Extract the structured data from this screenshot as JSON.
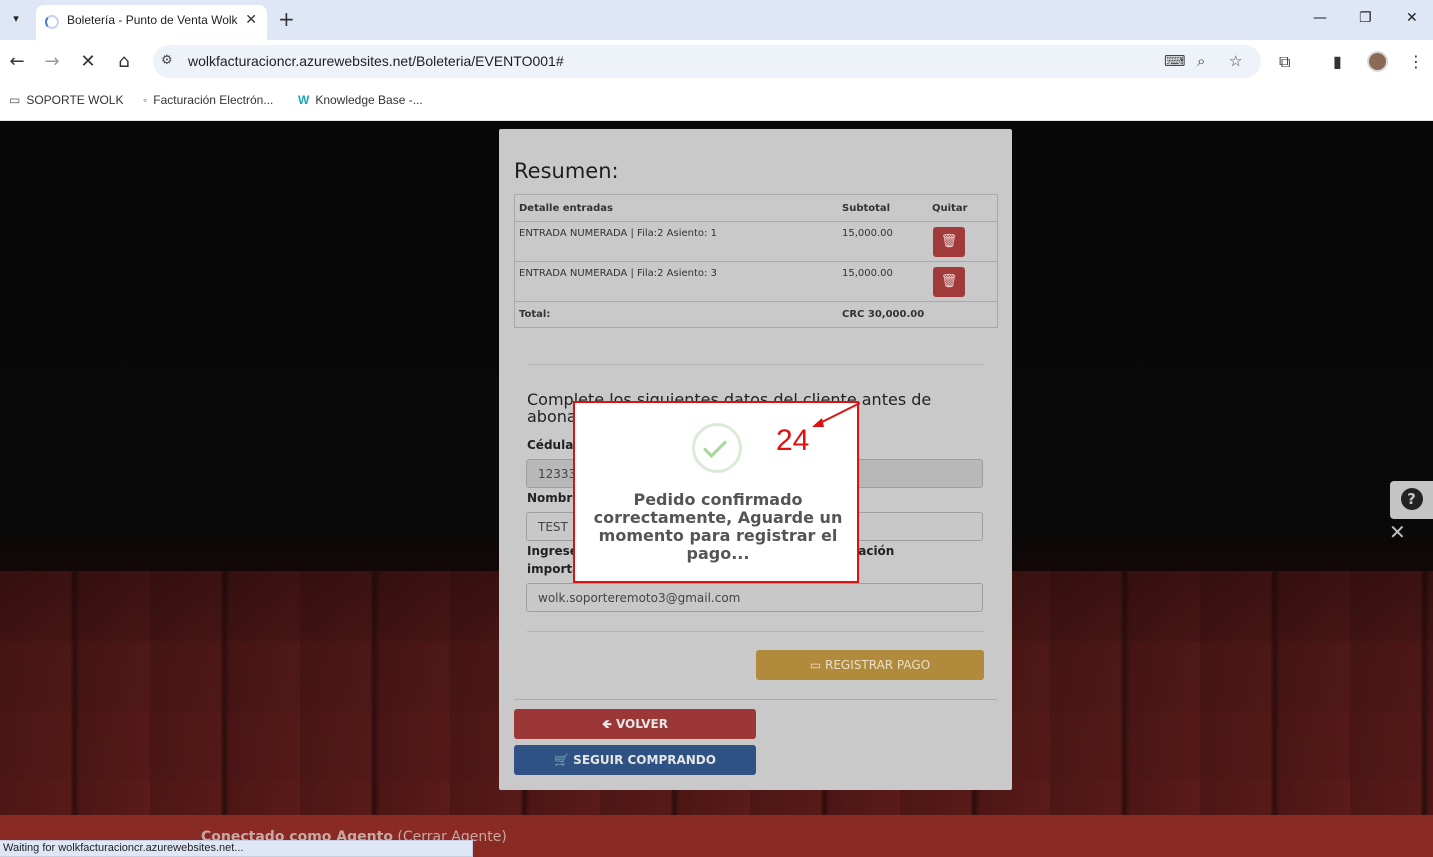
{
  "browser": {
    "tab_title": "Boletería - Punto de Venta Wolk",
    "url": "wolkfacturacioncr.azurewebsites.net/Boleteria/EVENTO001#",
    "bookmarks": [
      "SOPORTE WOLK",
      "Facturación Electrón...",
      "Knowledge Base -..."
    ],
    "status_text": "Waiting for wolkfacturacioncr.azurewebsites.net..."
  },
  "summary": {
    "title": "Resumen:",
    "headers": {
      "detail": "Detalle entradas",
      "subtotal": "Subtotal",
      "remove": "Quitar"
    },
    "items": [
      {
        "detail": "ENTRADA NUMERADA | Fila:2 Asiento: 1",
        "subtotal": "15,000.00"
      },
      {
        "detail": "ENTRADA NUMERADA | Fila:2 Asiento: 3",
        "subtotal": "15,000.00"
      }
    ],
    "total_label": "Total:",
    "total_value": "CRC 30,000.00"
  },
  "form": {
    "title": "Complete los siguientes datos del cliente antes de abonar",
    "cedula_label": "Cédula",
    "cedula_value": "12333",
    "nombre_label": "Nombre",
    "nombre_value": "TEST",
    "email_label": "Ingrese un correo electrónico para recibir información importante",
    "email_value": "wolk.soporteremoto3@gmail.com"
  },
  "buttons": {
    "pay": "REGISTRAR PAGO",
    "back": "VOLVER",
    "continue": "SEGUIR COMPRANDO"
  },
  "agent_bar": {
    "label": "Conectado como Agento",
    "action": "(Cerrar Agente)"
  },
  "modal": {
    "message": "Pedido confirmado correctamente, Aguarde un momento para registrar el pago..."
  },
  "annotation": {
    "number": "24",
    "color": "#e01010"
  }
}
